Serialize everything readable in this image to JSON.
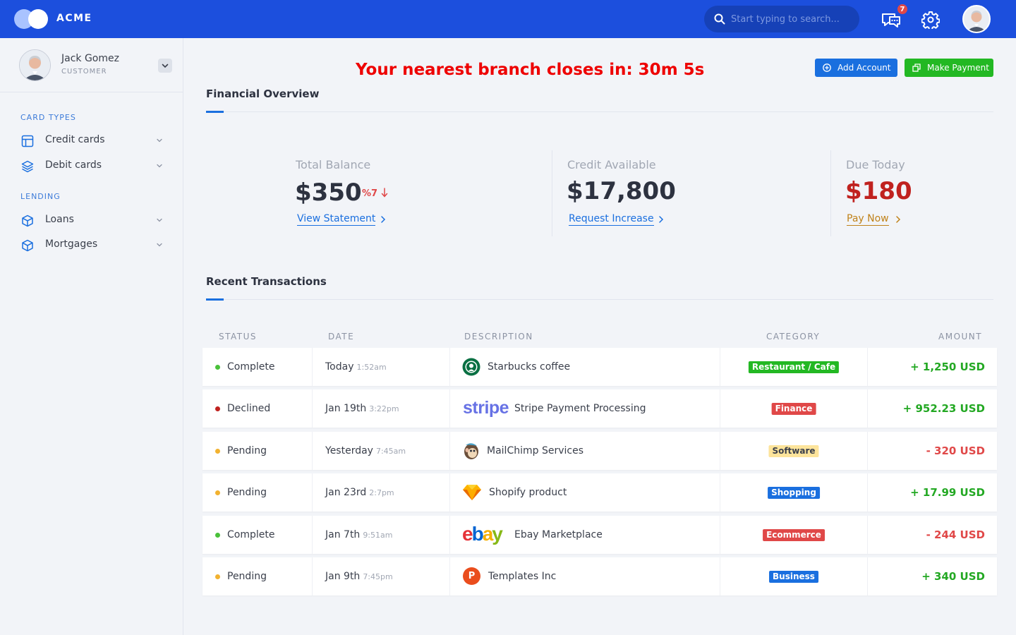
{
  "topbar": {
    "brand": "ACME",
    "search_placeholder": "Start typing to search...",
    "notification_count": "7"
  },
  "sidebar": {
    "user_name": "Jack Gomez",
    "user_role": "CUSTOMER",
    "sections": [
      {
        "label": "CARD TYPES",
        "items": [
          {
            "label": "Credit cards",
            "icon": "layout-icon"
          },
          {
            "label": "Debit cards",
            "icon": "layers-icon"
          }
        ]
      },
      {
        "label": "LENDING",
        "items": [
          {
            "label": "Loans",
            "icon": "box-icon"
          },
          {
            "label": "Mortgages",
            "icon": "box-icon"
          }
        ]
      }
    ]
  },
  "banner": {
    "countdown_text": "Your nearest branch closes in: 30m 5s"
  },
  "actions": {
    "add_account": "Add Account",
    "make_payment": "Make Payment"
  },
  "overview": {
    "title": "Financial Overview",
    "stats": [
      {
        "label": "Total Balance",
        "value": "$350",
        "delta": "%7",
        "link": "View Statement",
        "value_color": "#2d3240",
        "link_color": "#1a6fdf"
      },
      {
        "label": "Credit Available",
        "value": "$17,800",
        "link": "Request Increase",
        "value_color": "#2d3240",
        "link_color": "#1a6fdf"
      },
      {
        "label": "Due Today",
        "value": "$180",
        "link": "Pay Now",
        "value_color": "#c0221f",
        "link_color": "#c0821a"
      }
    ]
  },
  "transactions": {
    "title": "Recent Transactions",
    "columns": {
      "status": "STATUS",
      "date": "DATE",
      "description": "DESCRIPTION",
      "category": "CATEGORY",
      "amount": "AMOUNT"
    },
    "rows": [
      {
        "status": "Complete",
        "status_color": "#49c13a",
        "date": "Today",
        "time": "1:52am",
        "logo": "starbucks-logo",
        "description": "Starbucks coffee",
        "category": "Restaurant / Cafe",
        "category_bg": "#23b823",
        "category_fg": "#ffffff",
        "amount": "+ 1,250 USD",
        "amount_color": "#23a823"
      },
      {
        "status": "Declined",
        "status_color": "#c0221f",
        "date": "Jan 19th",
        "time": "3:22pm",
        "logo": "stripe-logo",
        "logo_text": "stripe",
        "description": "Stripe Payment Processing",
        "category": "Finance",
        "category_bg": "#e04848",
        "category_fg": "#ffffff",
        "amount": "+ 952.23 USD",
        "amount_color": "#23a823"
      },
      {
        "status": "Pending",
        "status_color": "#f2b230",
        "date": "Yesterday",
        "time": "7:45am",
        "logo": "mailchimp-logo",
        "description": "MailChimp Services",
        "category": "Software",
        "category_bg": "#fde49b",
        "category_fg": "#3a3f4b",
        "amount": "- 320 USD",
        "amount_color": "#e04848"
      },
      {
        "status": "Pending",
        "status_color": "#f2b230",
        "date": "Jan 23rd",
        "time": "2:7pm",
        "logo": "sketch-logo",
        "description": "Shopify product",
        "category": "Shopping",
        "category_bg": "#1a6fdf",
        "category_fg": "#ffffff",
        "amount": "+ 17.99 USD",
        "amount_color": "#23a823"
      },
      {
        "status": "Complete",
        "status_color": "#49c13a",
        "date": "Jan 7th",
        "time": "9:51am",
        "logo": "ebay-logo",
        "logo_text": "ebay",
        "description": "Ebay Marketplace",
        "category": "Ecommerce",
        "category_bg": "#e04848",
        "category_fg": "#ffffff",
        "amount": "- 244 USD",
        "amount_color": "#e04848"
      },
      {
        "status": "Pending",
        "status_color": "#f2b230",
        "date": "Jan 9th",
        "time": "7:45pm",
        "logo": "producthunt-logo",
        "logo_text": "P",
        "description": "Templates Inc",
        "category": "Business",
        "category_bg": "#1a6fdf",
        "category_fg": "#ffffff",
        "amount": "+ 340 USD",
        "amount_color": "#23a823"
      }
    ]
  }
}
